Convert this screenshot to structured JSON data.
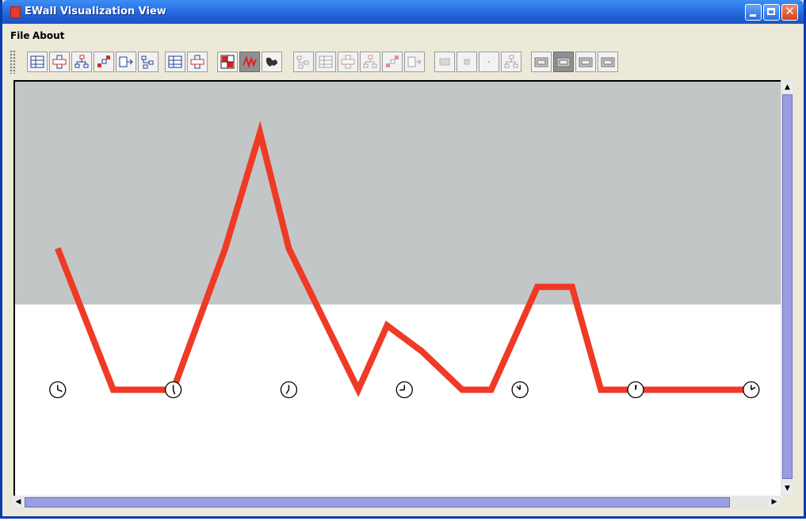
{
  "window": {
    "title": "EWall Visualization View",
    "accent": "#2b72e6",
    "minimize_label": "",
    "maximize_label": "",
    "close_label": "✕"
  },
  "menu": {
    "items": [
      "File",
      "About"
    ]
  },
  "toolbar": {
    "buttons": [
      {
        "icon": "grid-table-icon"
      },
      {
        "icon": "cross-grid-icon"
      },
      {
        "icon": "hierarchy-tree-icon"
      },
      {
        "icon": "stair-chart-icon"
      },
      {
        "icon": "table-arrow-icon"
      },
      {
        "icon": "tree-branch-icon"
      },
      {
        "icon": "node-link-icon"
      },
      {
        "icon": "cluster-layout-icon"
      },
      {
        "icon": "red-grid-icon"
      },
      {
        "icon": "line-chart-icon"
      },
      {
        "icon": "world-map-icon"
      },
      {
        "icon": "branch-faded-icon"
      },
      {
        "icon": "pen-faded-icon"
      },
      {
        "icon": "align-faded-icon"
      },
      {
        "icon": "select-box-icon"
      },
      {
        "icon": "org-faded-icon"
      },
      {
        "icon": "scatter-faded-icon"
      },
      {
        "icon": "large-square-icon"
      },
      {
        "icon": "small-square-icon"
      },
      {
        "icon": "dot-icon"
      },
      {
        "icon": "branch-small-icon"
      },
      {
        "icon": "window-small-icon"
      },
      {
        "icon": "window-medium-icon"
      },
      {
        "icon": "window-wide-icon"
      },
      {
        "icon": "window-plus-icon"
      }
    ],
    "pressed": [
      9,
      22
    ]
  },
  "chart_data": {
    "type": "line",
    "line_color": "#ef3a26",
    "background_color": "#c3c6c6",
    "series": [
      {
        "values": [
          {
            "x": 0.0,
            "y": 0.22
          },
          {
            "x": 0.48,
            "y": 0.0
          },
          {
            "x": 1.0,
            "y": 0.0
          },
          {
            "x": 1.45,
            "y": 0.22
          },
          {
            "x": 1.75,
            "y": 0.4
          },
          {
            "x": 2.0,
            "y": 0.22
          },
          {
            "x": 2.6,
            "y": 0.0
          },
          {
            "x": 2.85,
            "y": 0.1
          },
          {
            "x": 3.15,
            "y": 0.06
          },
          {
            "x": 3.5,
            "y": 0.0
          },
          {
            "x": 3.75,
            "y": 0.0
          },
          {
            "x": 4.15,
            "y": 0.16
          },
          {
            "x": 4.45,
            "y": 0.16
          },
          {
            "x": 4.7,
            "y": 0.0
          },
          {
            "x": 6.0,
            "y": 0.0
          }
        ]
      }
    ],
    "markers": [
      {
        "x": 0.0,
        "glyph": "clock-icon"
      },
      {
        "x": 1.0,
        "glyph": "clock-icon"
      },
      {
        "x": 2.0,
        "glyph": "clock-icon"
      },
      {
        "x": 3.0,
        "glyph": "clock-icon"
      },
      {
        "x": 4.0,
        "glyph": "clock-icon"
      },
      {
        "x": 5.0,
        "glyph": "clock-icon"
      },
      {
        "x": 6.0,
        "glyph": "clock-icon"
      }
    ],
    "xlim": [
      -0.3,
      6.2
    ],
    "ylim": [
      -0.05,
      0.43
    ]
  }
}
